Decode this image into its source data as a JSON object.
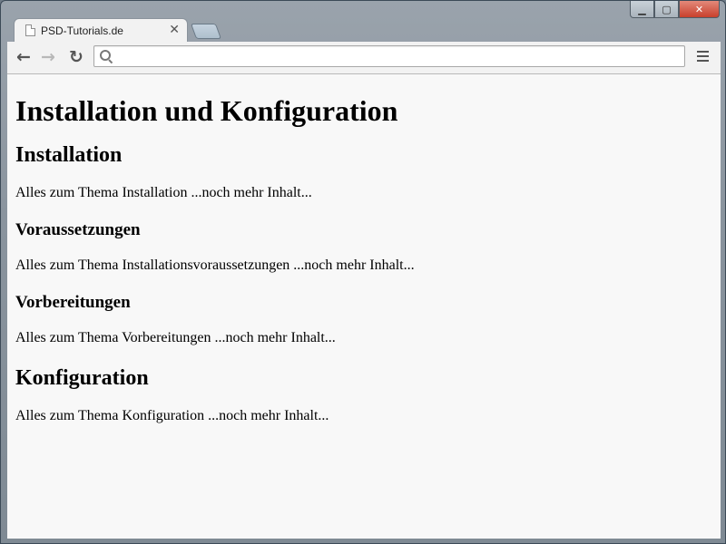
{
  "browser": {
    "tab_title": "PSD-Tutorials.de",
    "tab_close_glyph": "✕",
    "new_tab_label": "",
    "window_controls": {
      "minimize": "▁",
      "maximize": "▢",
      "close": "✕"
    },
    "nav": {
      "back_icon": "←",
      "forward_icon": "→",
      "reload_icon": "↻"
    },
    "omnibox": {
      "value": "",
      "placeholder": ""
    }
  },
  "page": {
    "h1": "Installation und Konfiguration",
    "sections": [
      {
        "heading": "Installation",
        "text": "Alles zum Thema Installation ...noch mehr Inhalt..."
      },
      {
        "heading": "Voraussetzungen",
        "text": "Alles zum Thema Installationsvoraussetzungen ...noch mehr Inhalt..."
      },
      {
        "heading": "Vorbereitungen",
        "text": "Alles zum Thema Vorbereitungen ...noch mehr Inhalt..."
      },
      {
        "heading": "Konfiguration",
        "text": "Alles zum Thema Konfiguration ...noch mehr Inhalt..."
      }
    ]
  }
}
